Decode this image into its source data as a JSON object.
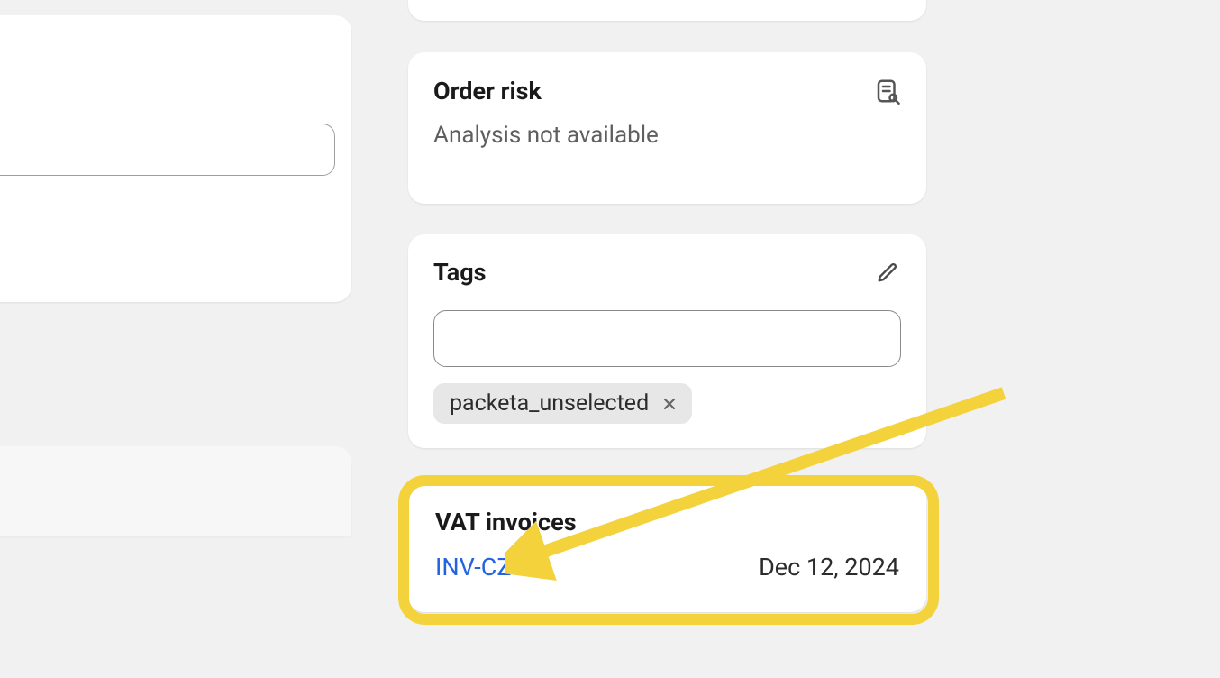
{
  "order_risk": {
    "title": "Order risk",
    "status": "Analysis not available"
  },
  "tags": {
    "title": "Tags",
    "input_value": "",
    "items": [
      {
        "label": "packeta_unselected"
      }
    ]
  },
  "vat_invoices": {
    "title": "VAT invoices",
    "rows": [
      {
        "link": "INV-CZ-1",
        "date": "Dec 12, 2024"
      }
    ]
  },
  "annotation": {
    "highlight_color": "#f3d23b"
  }
}
